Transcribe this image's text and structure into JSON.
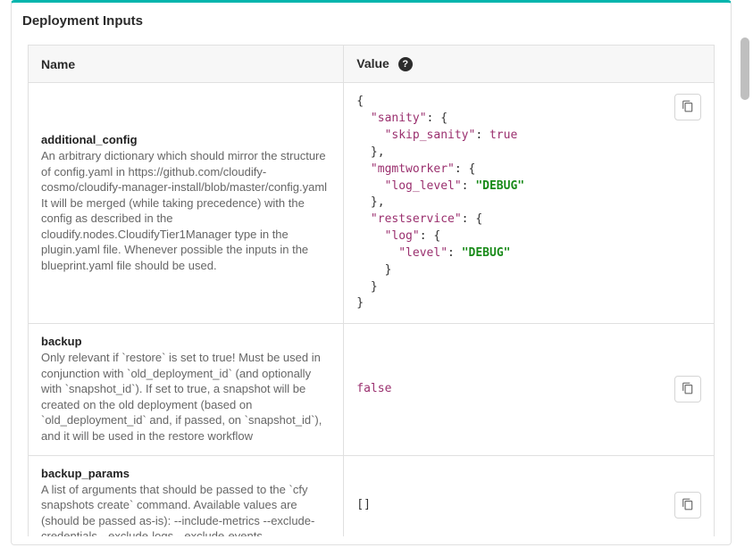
{
  "panel": {
    "title": "Deployment Inputs"
  },
  "headers": {
    "name": "Name",
    "value": "Value"
  },
  "help_icon_char": "?",
  "rows": [
    {
      "name": "additional_config",
      "desc": "An arbitrary dictionary which should mirror the structure of config.yaml in https://github.com/cloudify-cosmo/cloudify-manager-install/blob/master/config.yaml It will be merged (while taking precedence) with the config as described in the cloudify.nodes.CloudifyTier1Manager type in the plugin.yaml file. Whenever possible the inputs in the blueprint.yaml file should be used.",
      "value": {
        "sanity": {
          "skip_sanity": true
        },
        "mgmtworker": {
          "log_level": "DEBUG"
        },
        "restservice": {
          "log": {
            "level": "DEBUG"
          }
        }
      }
    },
    {
      "name": "backup",
      "desc": "Only relevant if `restore` is set to true! Must be used in conjunction with `old_deployment_id` (and optionally with `snapshot_id`). If set to true, a snapshot will be created on the old deployment (based on `old_deployment_id` and, if passed, on `snapshot_id`), and it will be used in the restore workflow",
      "value": false
    },
    {
      "name": "backup_params",
      "desc": "A list of arguments that should be passed to the `cfy snapshots create` command. Available values are (should be passed as-is): --include-metrics --exclude-credentials --exclude-logs --exclude-events",
      "value": []
    }
  ]
}
